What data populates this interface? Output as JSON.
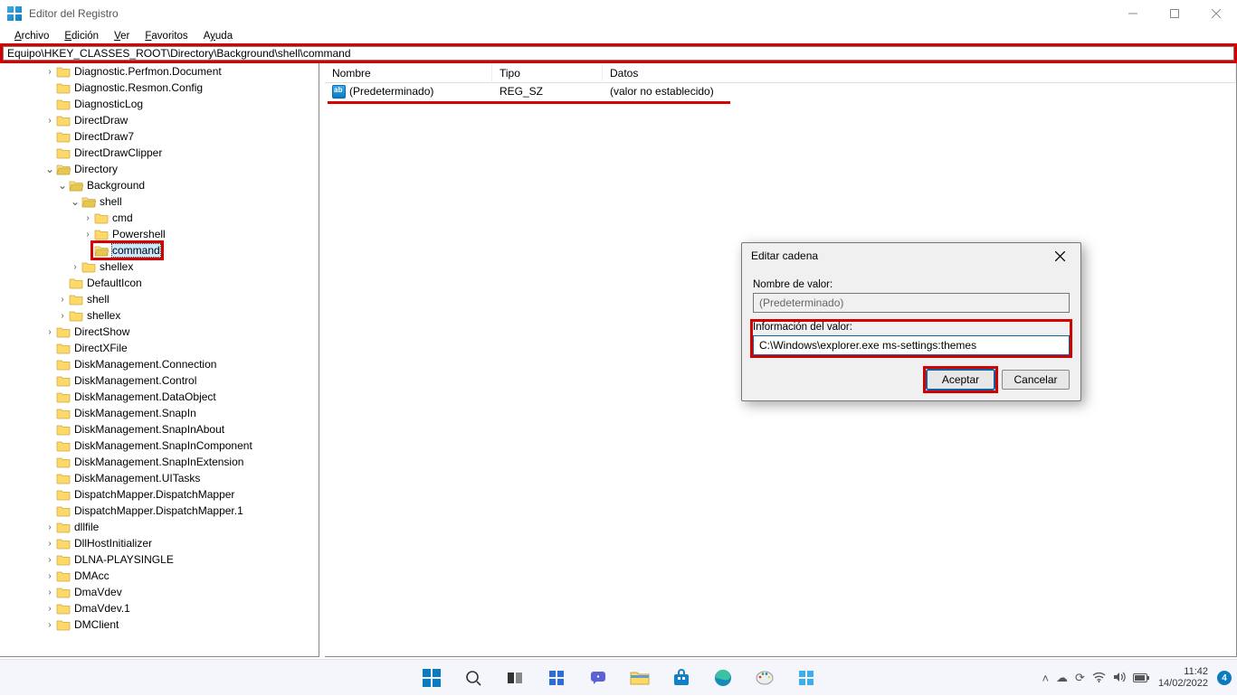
{
  "window": {
    "title": "Editor del Registro"
  },
  "menu": {
    "file": "Archivo",
    "edit": "Edición",
    "view": "Ver",
    "favorites": "Favoritos",
    "help": "Ayuda"
  },
  "address": {
    "value": "Equipo\\HKEY_CLASSES_ROOT\\Directory\\Background\\shell\\command"
  },
  "tree": {
    "items": [
      {
        "depth": 3,
        "chev": ">",
        "label": "Diagnostic.Perfmon.Document"
      },
      {
        "depth": 3,
        "chev": "",
        "label": "Diagnostic.Resmon.Config"
      },
      {
        "depth": 3,
        "chev": "",
        "label": "DiagnosticLog"
      },
      {
        "depth": 3,
        "chev": ">",
        "label": "DirectDraw"
      },
      {
        "depth": 3,
        "chev": "",
        "label": "DirectDraw7"
      },
      {
        "depth": 3,
        "chev": "",
        "label": "DirectDrawClipper"
      },
      {
        "depth": 3,
        "chev": "v",
        "label": "Directory",
        "open": true
      },
      {
        "depth": 4,
        "chev": "v",
        "label": "Background",
        "open": true
      },
      {
        "depth": 5,
        "chev": "v",
        "label": "shell",
        "open": true
      },
      {
        "depth": 6,
        "chev": ">",
        "label": "cmd"
      },
      {
        "depth": 6,
        "chev": ">",
        "label": "Powershell"
      },
      {
        "depth": 6,
        "chev": "",
        "label": "command",
        "selected": true,
        "redbox": true,
        "open": true
      },
      {
        "depth": 5,
        "chev": ">",
        "label": "shellex"
      },
      {
        "depth": 4,
        "chev": "",
        "label": "DefaultIcon"
      },
      {
        "depth": 4,
        "chev": ">",
        "label": "shell"
      },
      {
        "depth": 4,
        "chev": ">",
        "label": "shellex"
      },
      {
        "depth": 3,
        "chev": ">",
        "label": "DirectShow"
      },
      {
        "depth": 3,
        "chev": "",
        "label": "DirectXFile"
      },
      {
        "depth": 3,
        "chev": "",
        "label": "DiskManagement.Connection"
      },
      {
        "depth": 3,
        "chev": "",
        "label": "DiskManagement.Control"
      },
      {
        "depth": 3,
        "chev": "",
        "label": "DiskManagement.DataObject"
      },
      {
        "depth": 3,
        "chev": "",
        "label": "DiskManagement.SnapIn"
      },
      {
        "depth": 3,
        "chev": "",
        "label": "DiskManagement.SnapInAbout"
      },
      {
        "depth": 3,
        "chev": "",
        "label": "DiskManagement.SnapInComponent"
      },
      {
        "depth": 3,
        "chev": "",
        "label": "DiskManagement.SnapInExtension"
      },
      {
        "depth": 3,
        "chev": "",
        "label": "DiskManagement.UITasks"
      },
      {
        "depth": 3,
        "chev": "",
        "label": "DispatchMapper.DispatchMapper"
      },
      {
        "depth": 3,
        "chev": "",
        "label": "DispatchMapper.DispatchMapper.1"
      },
      {
        "depth": 3,
        "chev": ">",
        "label": "dllfile"
      },
      {
        "depth": 3,
        "chev": ">",
        "label": "DllHostInitializer"
      },
      {
        "depth": 3,
        "chev": ">",
        "label": "DLNA-PLAYSINGLE"
      },
      {
        "depth": 3,
        "chev": ">",
        "label": "DMAcc"
      },
      {
        "depth": 3,
        "chev": ">",
        "label": "DmaVdev"
      },
      {
        "depth": 3,
        "chev": ">",
        "label": "DmaVdev.1"
      },
      {
        "depth": 3,
        "chev": ">",
        "label": "DMClient"
      }
    ]
  },
  "values": {
    "columns": {
      "name": "Nombre",
      "type": "Tipo",
      "data": "Datos"
    },
    "rows": [
      {
        "name": "(Predeterminado)",
        "type": "REG_SZ",
        "data": "(valor no establecido)"
      }
    ]
  },
  "dialog": {
    "title": "Editar cadena",
    "name_label": "Nombre de valor:",
    "name_value": "(Predeterminado)",
    "data_label": "Información del valor:",
    "data_value": "C:\\Windows\\explorer.exe ms-settings:themes",
    "ok": "Aceptar",
    "cancel": "Cancelar"
  },
  "taskbar": {
    "time": "11:42",
    "date": "14/02/2022",
    "notif_count": "4"
  }
}
